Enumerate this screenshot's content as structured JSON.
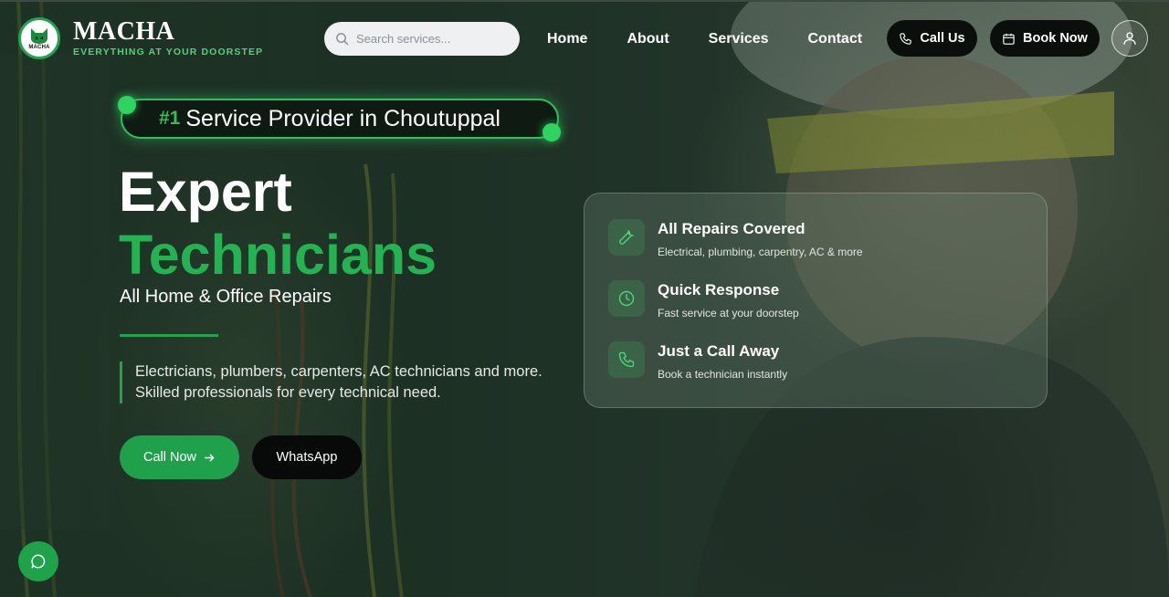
{
  "brand": {
    "title": "MACHA",
    "tagline": "EVERYTHING AT YOUR DOORSTEP",
    "badge_text": "MACHA",
    "accent": "#22a34f"
  },
  "search": {
    "placeholder": "Search services...",
    "icon": "search-icon"
  },
  "nav": {
    "items": [
      "Home",
      "About",
      "Services",
      "Contact"
    ]
  },
  "header_actions": {
    "call_label": "Call Us",
    "call_icon": "phone-icon",
    "book_label": "Book Now",
    "book_icon": "calendar-icon",
    "profile_icon": "user-icon"
  },
  "hero": {
    "badge_rank": "#1",
    "badge_text": "Service Provider in Choutuppal",
    "heading_line1": "Expert",
    "heading_line2": "Technicians",
    "subheading": "All Home & Office Repairs",
    "description": "Electricians, plumbers, carpenters, AC technicians and more. Skilled professionals for every technical need.",
    "primary_button": "Call Now",
    "secondary_button": "WhatsApp"
  },
  "features": [
    {
      "icon": "wrench-icon",
      "title": "All Repairs Covered",
      "desc": "Electrical, plumbing, carpentry, AC & more"
    },
    {
      "icon": "clock-icon",
      "title": "Quick Response",
      "desc": "Fast service at your doorstep"
    },
    {
      "icon": "phone-icon",
      "title": "Just a Call Away",
      "desc": "Book a technician instantly"
    }
  ],
  "chat": {
    "icon": "chat-icon"
  }
}
